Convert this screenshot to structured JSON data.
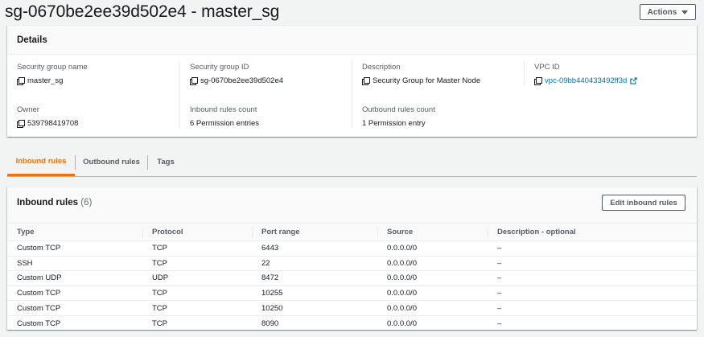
{
  "page": {
    "title": "sg-0670be2ee39d502e4 - master_sg",
    "actions_label": "Actions"
  },
  "details": {
    "header": "Details",
    "fields": {
      "sg_name": {
        "label": "Security group name",
        "value": "master_sg"
      },
      "sg_id": {
        "label": "Security group ID",
        "value": "sg-0670be2ee39d502e4"
      },
      "description": {
        "label": "Description",
        "value": "Security Group for Master Node"
      },
      "vpc_id": {
        "label": "VPC ID",
        "value": "vpc-09bb440433492ff3d"
      },
      "owner": {
        "label": "Owner",
        "value": "539798419708"
      },
      "inbound_count": {
        "label": "Inbound rules count",
        "value": "6 Permission entries"
      },
      "outbound_count": {
        "label": "Outbound rules count",
        "value": "1 Permission entry"
      }
    }
  },
  "tabs": [
    {
      "label": "Inbound rules",
      "active": true
    },
    {
      "label": "Outbound rules",
      "active": false
    },
    {
      "label": "Tags",
      "active": false
    }
  ],
  "inbound": {
    "title": "Inbound rules",
    "count": "(6)",
    "edit_label": "Edit inbound rules",
    "columns": [
      "Type",
      "Protocol",
      "Port range",
      "Source",
      "Description - optional"
    ],
    "rows": [
      [
        "Custom TCP",
        "TCP",
        "6443",
        "0.0.0.0/0",
        "–"
      ],
      [
        "SSH",
        "TCP",
        "22",
        "0.0.0.0/0",
        "–"
      ],
      [
        "Custom UDP",
        "UDP",
        "8472",
        "0.0.0.0/0",
        "–"
      ],
      [
        "Custom TCP",
        "TCP",
        "10255",
        "0.0.0.0/0",
        "–"
      ],
      [
        "Custom TCP",
        "TCP",
        "10250",
        "0.0.0.0/0",
        "–"
      ],
      [
        "Custom TCP",
        "TCP",
        "8090",
        "0.0.0.0/0",
        "–"
      ]
    ]
  },
  "colors": {
    "link": "#0073bb",
    "active_tab": "#ec7211"
  },
  "icons": {
    "copy": "copy-icon",
    "external": "external-link-icon",
    "dropdown": "caret-down-icon"
  }
}
